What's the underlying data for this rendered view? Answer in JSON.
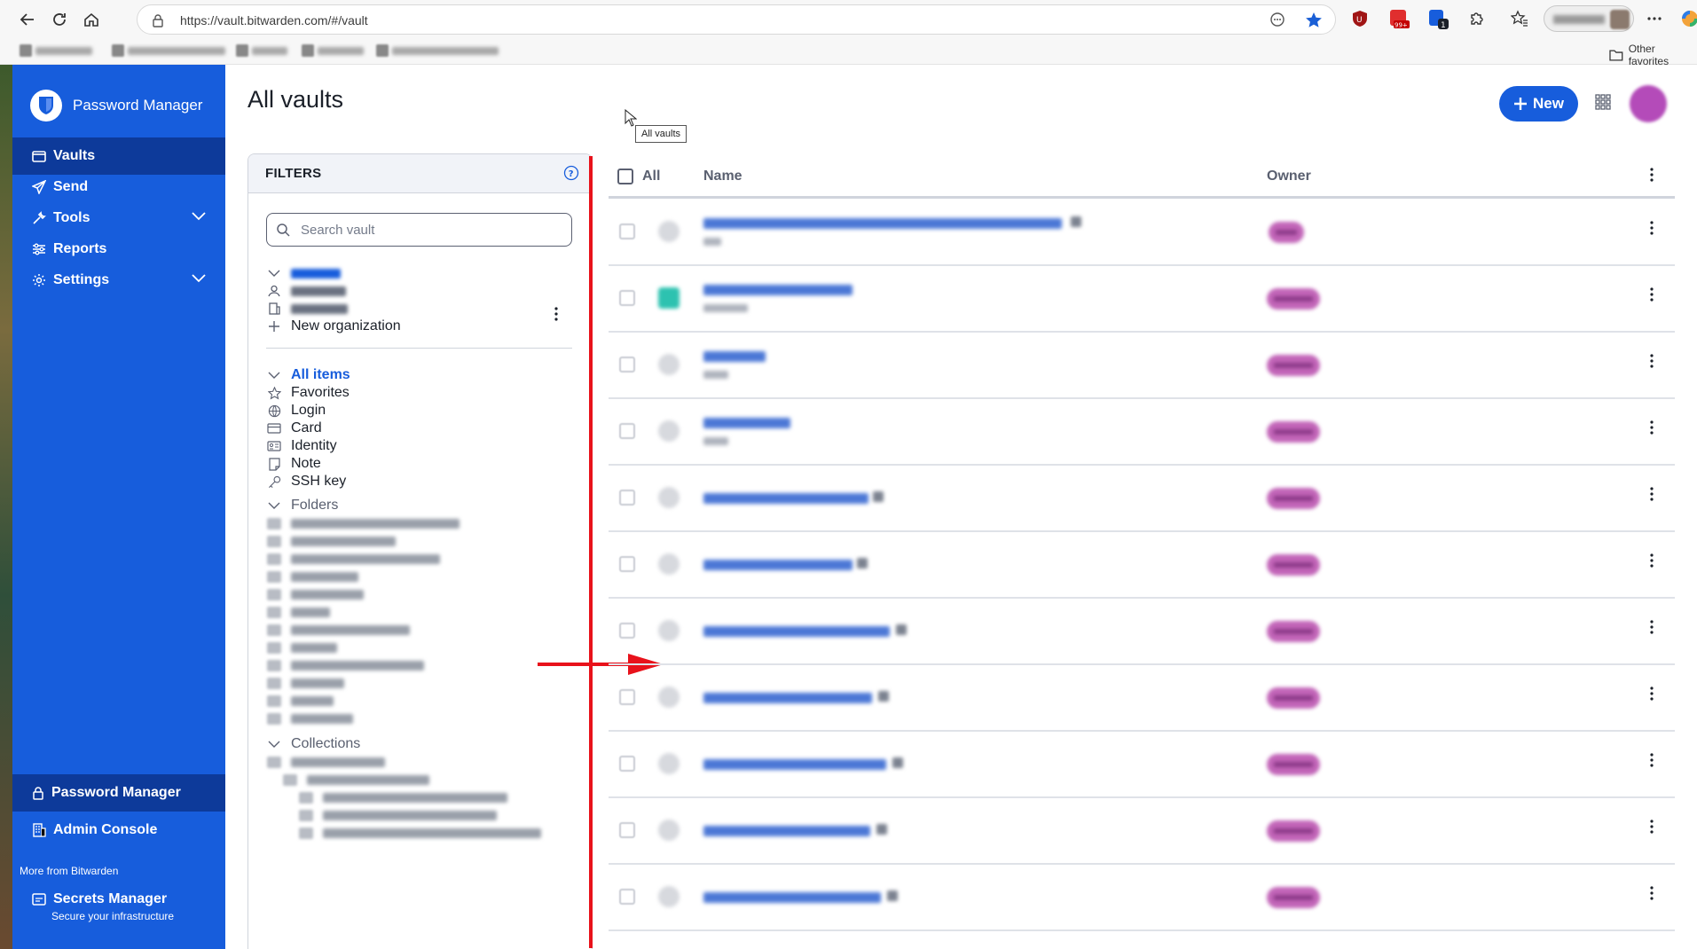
{
  "browser": {
    "url": "https://vault.bitwarden.com/#/vault",
    "other_favorites": "Other favorites",
    "ext_badge_1": "99+",
    "ext_badge_2": "1"
  },
  "sidebar": {
    "product": "Password Manager",
    "nav": [
      {
        "label": "Vaults",
        "icon": "vault-icon"
      },
      {
        "label": "Send",
        "icon": "send-icon"
      },
      {
        "label": "Tools",
        "icon": "tools-icon"
      },
      {
        "label": "Reports",
        "icon": "reports-icon"
      },
      {
        "label": "Settings",
        "icon": "settings-icon"
      }
    ],
    "bottom": [
      {
        "label": "Password Manager",
        "icon": "lock-icon"
      },
      {
        "label": "Admin Console",
        "icon": "building-icon"
      }
    ],
    "more_label": "More from Bitwarden",
    "secrets": {
      "title": "Secrets Manager",
      "subtitle": "Secure your infrastructure"
    }
  },
  "header": {
    "title": "All vaults",
    "tooltip": "All vaults",
    "new_button": "New"
  },
  "filters": {
    "title": "FILTERS",
    "search_placeholder": "Search vault",
    "new_org": "New organization",
    "types": [
      "All items",
      "Favorites",
      "Login",
      "Card",
      "Identity",
      "Note",
      "SSH key"
    ],
    "folders_label": "Folders",
    "collections_label": "Collections"
  },
  "table": {
    "all_label": "All",
    "name_header": "Name",
    "owner_header": "Owner"
  },
  "colors": {
    "brand_blue": "#175ddc",
    "sidebar_active": "#0d3a9a",
    "annotation_red": "#e8121b",
    "owner_badge": "#c265b8"
  }
}
